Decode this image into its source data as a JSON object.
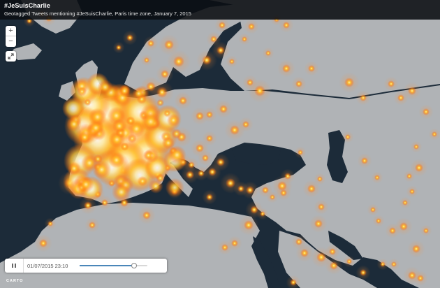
{
  "header": {
    "title": "#JeSuisCharlie",
    "subtitle": "Geotagged Tweets mentioning #JeSuisCharlie, Paris time zone, January 7, 2015"
  },
  "zoom": {
    "in_label": "+",
    "out_label": "−"
  },
  "player": {
    "timestamp": "01/07/2015 23:10",
    "progress": 0.8
  },
  "attribution": {
    "text": "CARTO"
  },
  "colors": {
    "ocean": "#1b2a38",
    "land": "#aeb1b4",
    "hotspot_core": "#fff9dc",
    "hotspot_mid": "#ffd23c",
    "hotspot_outer": "#ff7a12"
  }
}
